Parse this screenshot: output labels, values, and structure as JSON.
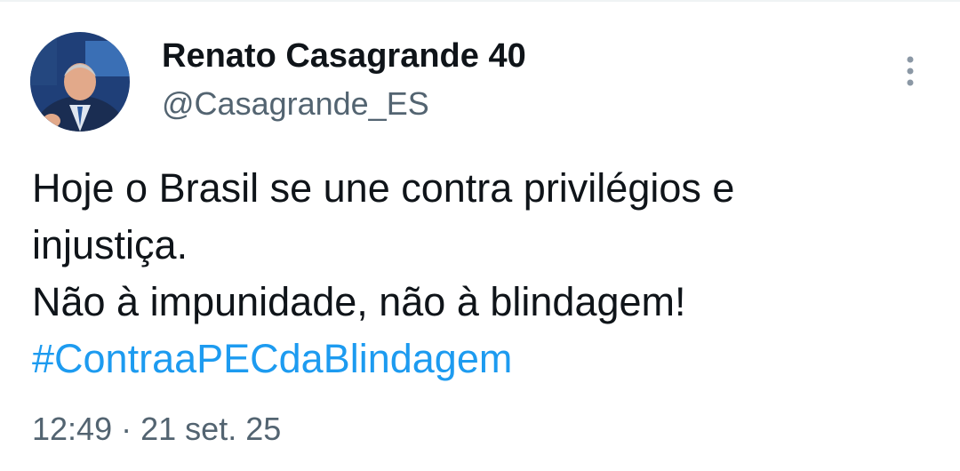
{
  "author": {
    "display_name": "Renato Casagrande 40",
    "handle": "@Casagrande_ES"
  },
  "tweet": {
    "lines": [
      "Hoje o Brasil se une contra privilégios e",
      "injustiça.",
      "Não à impunidade, não à blindagem!"
    ],
    "hashtag": "#ContraaPECdaBlindagem"
  },
  "meta": {
    "time": "12:49",
    "separator": "·",
    "date": "21 set. 25"
  },
  "icons": {
    "more": "more-vertical-icon",
    "avatar": "profile-photo"
  },
  "colors": {
    "text": "#0f1419",
    "secondary": "#536471",
    "link": "#1d9bf0"
  }
}
